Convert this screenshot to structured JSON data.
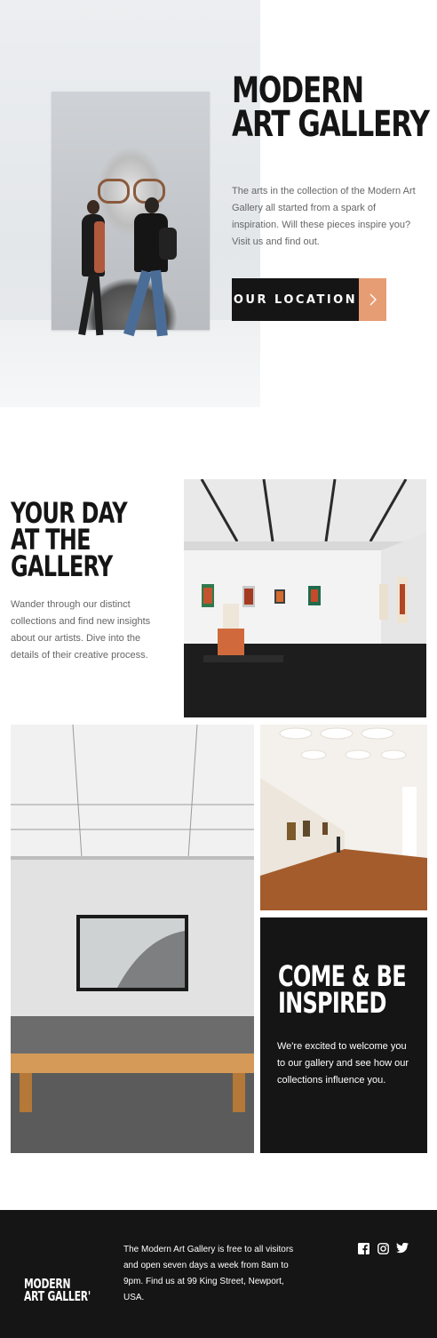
{
  "hero": {
    "title_line1": "MODERN",
    "title_line2": "ART GALLERY",
    "description": "The arts in the collection of the Modern Art Gallery all started from a spark of inspiration. Will these pieces inspire you? Visit us and find out.",
    "button_label": "OUR LOCATION",
    "button_icon": "chevron-right-icon"
  },
  "day_section": {
    "title_line1": "YOUR DAY",
    "title_line2": "AT THE",
    "title_line3": "GALLERY",
    "description": "Wander through our distinct collections and find new insights about our artists. Dive into the details of their creative process."
  },
  "inspired_section": {
    "title_line1": "COME & BE",
    "title_line2": "INSPIRED",
    "description": "We're excited to welcome you to our gallery and see how our collections influence you."
  },
  "footer": {
    "logo_line1": "MODERN",
    "logo_line2": "ART GALLER'",
    "info": "The Modern Art Gallery is free to all visitors and open seven days a week from 8am to 9pm. Find us at 99 King Street, Newport, USA.",
    "socials": [
      "facebook-icon",
      "instagram-icon",
      "twitter-icon"
    ]
  },
  "colors": {
    "dark": "#151515",
    "accent": "#e79d73",
    "body_text": "#666666",
    "white": "#ffffff"
  }
}
